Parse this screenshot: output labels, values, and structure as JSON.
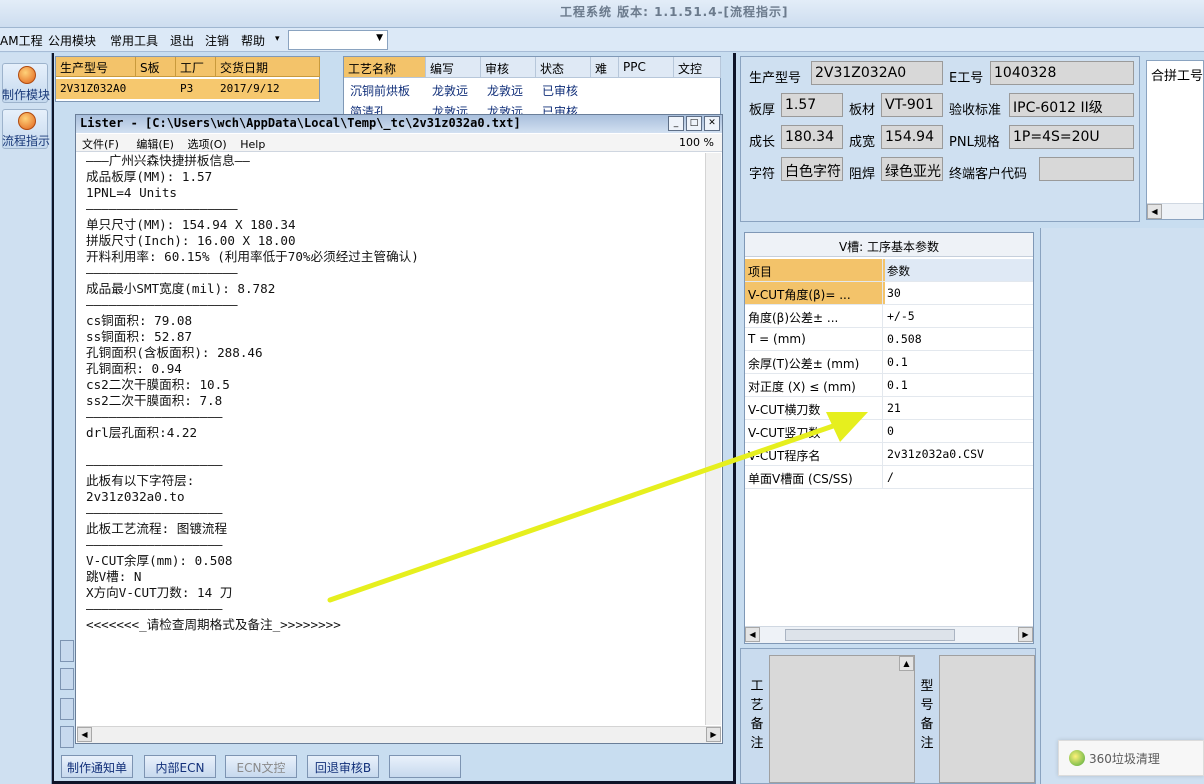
{
  "app": {
    "title": "工程系统  版本: 1.1.51.4-[流程指示]"
  },
  "menu": {
    "items": [
      "AM工程",
      "公用模块",
      "常用工具",
      "退出",
      "注销",
      "帮助"
    ],
    "combo": ""
  },
  "leftbar": {
    "buttons": [
      "制作模块",
      "流程指示"
    ]
  },
  "grid1": {
    "headers": [
      "生产型号",
      "S板",
      "工厂",
      "交货日期"
    ],
    "row": [
      "2V31Z032A0",
      "",
      "P3",
      "2017/9/12"
    ]
  },
  "grid2": {
    "headers": [
      "工艺名称",
      "编写",
      "审核",
      "状态",
      "难",
      "PPC",
      "文控"
    ],
    "row": [
      "沉铜前烘板",
      "龙敦远",
      "龙敦远",
      "已审核"
    ],
    "row2": [
      "简清孔",
      "龙敦远",
      "龙敦远",
      "已审核"
    ]
  },
  "lister": {
    "title": "Lister - [C:\\Users\\wch\\AppData\\Local\\Temp\\_tc\\2v31z032a0.txt]",
    "menu": [
      "文件(F)",
      "编辑(E)",
      "选项(O)",
      "Help"
    ],
    "zoom": "100 %",
    "lines": [
      "———广州兴森快捷拼板信息——",
      "成品板厚(MM): 1.57",
      "1PNL=4 Units",
      "————————————————————",
      "单只尺寸(MM): 154.94 X 180.34",
      "拼版尺寸(Inch): 16.00 X 18.00",
      "开料利用率: 60.15% (利用率低于70%必须经过主管确认)",
      "————————————————————",
      "成品最小SMT宽度(mil): 8.782",
      "————————————————————",
      "cs铜面积: 79.08",
      "ss铜面积: 52.87",
      "孔铜面积(含板面积): 288.46",
      "孔铜面积: 0.94",
      "cs2二次干膜面积: 10.5",
      "ss2二次干膜面积: 7.8",
      "——————————————————",
      "drl层孔面积:4.22",
      "",
      "——————————————————",
      "此板有以下字符层:",
      "2v31z032a0.to",
      "——————————————————",
      "此板工艺流程: 图镀流程",
      "——————————————————",
      "V-CUT余厚(mm): 0.508",
      "跳V槽: N",
      "X方向V-CUT刀数: 14 刀",
      "——————————————————",
      "<<<<<<<_请检查周期格式及备注_>>>>>>>>"
    ]
  },
  "bottom_buttons": [
    "制作通知单",
    "内部ECN",
    "ECN文控",
    "回退审核B",
    ""
  ],
  "info": {
    "labels": {
      "model": "生产型号",
      "eno": "E工号",
      "thick": "板厚",
      "material": "板材",
      "std": "验收标准",
      "len": "成长",
      "wid": "成宽",
      "pnl": "PNL规格",
      "char": "字符",
      "mask": "阻焊",
      "cust": "终端客户代码",
      "combine": "合拼工号"
    },
    "values": {
      "model": "2V31Z032A0",
      "eno": "1040328",
      "thick": "1.57",
      "material": "VT-901",
      "std": "IPC-6012 II级",
      "len": "180.34",
      "wid": "154.94",
      "pnl": "1P=4S=20U",
      "char": "白色字符",
      "mask": "绿色亚光",
      "cust": ""
    }
  },
  "vcut": {
    "title": "V槽: 工序基本参数",
    "headers": [
      "项目",
      "参数"
    ],
    "rows": [
      [
        "V-CUT角度(β)=  ...",
        "30"
      ],
      [
        "角度(β)公差±  ...",
        "+/-5"
      ],
      [
        "T =  (mm)",
        "0.508"
      ],
      [
        "余厚(T)公差±  (mm)",
        "0.1"
      ],
      [
        "对正度 (X) ≤ (mm)",
        "0.1"
      ],
      [
        "V-CUT横刀数",
        "21"
      ],
      [
        "V-CUT竖刀数",
        "0"
      ],
      [
        "V-CUT程序名",
        "2v31z032a0.CSV"
      ],
      [
        "单面V槽面 (CS/SS)",
        "/"
      ]
    ]
  },
  "notes": {
    "left": [
      "工",
      "艺",
      "备",
      "注"
    ],
    "right": [
      "型",
      "号",
      "备",
      "注"
    ]
  },
  "toast": {
    "text": "360垃圾清理"
  }
}
